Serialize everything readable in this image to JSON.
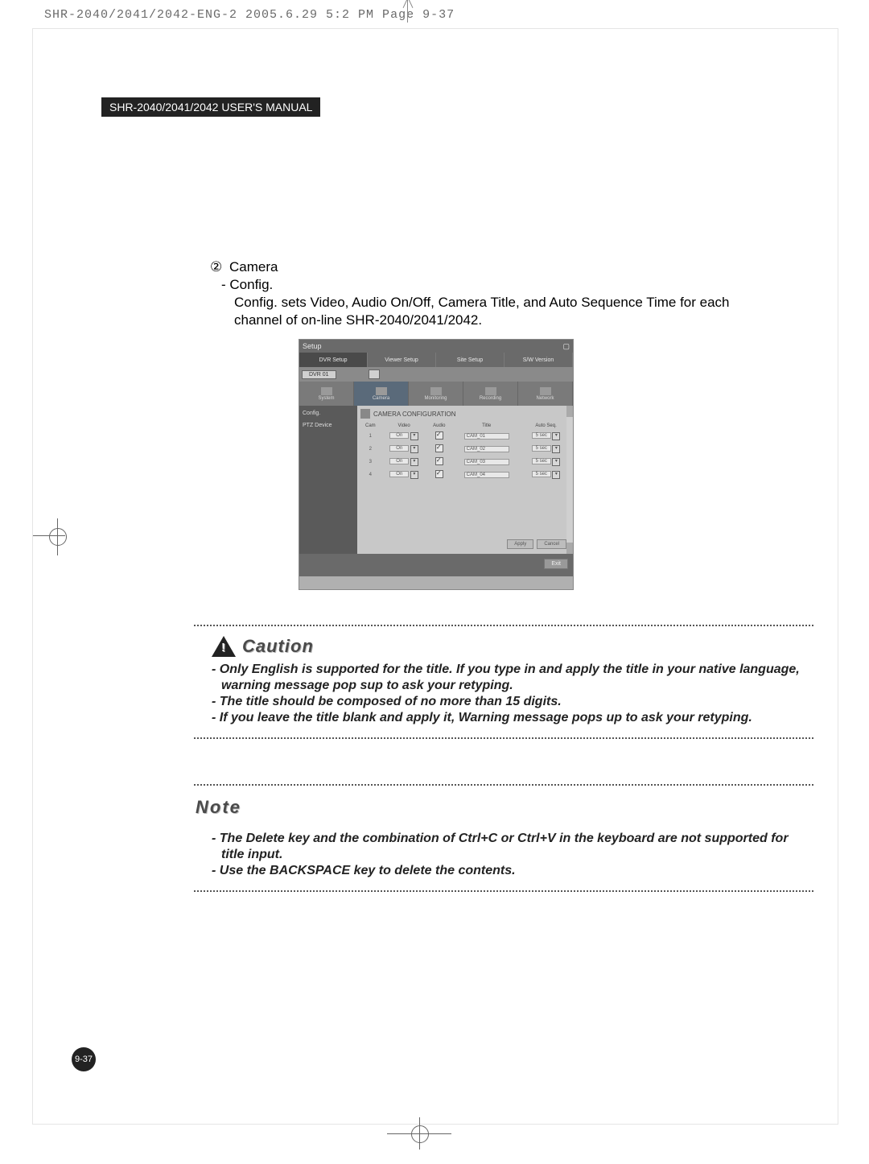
{
  "print_header": "SHR-2040/2041/2042-ENG-2  2005.6.29  5:2 PM  Page 9-37",
  "header_bar": "SHR-2040/2041/2042 USER'S MANUAL",
  "section": {
    "num": "②",
    "title": "Camera",
    "sub": "- Config.",
    "desc": "Config. sets Video, Audio On/Off, Camera Title, and Auto Sequence Time for each channel of on-line SHR-2040/2041/2042."
  },
  "screenshot": {
    "title": "Setup",
    "tabs": [
      "DVR Setup",
      "Viewer Setup",
      "Site Setup",
      "S/W Version"
    ],
    "dvr_label": "DVR 01",
    "navtabs": [
      "System",
      "Camera",
      "Monitoring",
      "Recording",
      "Network"
    ],
    "side": [
      "Config.",
      "PTZ Device"
    ],
    "main_title": "CAMERA CONFIGURATION",
    "columns": [
      "Cam",
      "Video",
      "Audio",
      "Title",
      "Auto Seq."
    ],
    "rows": [
      {
        "cam": "1",
        "video": "On",
        "title": "CAM_01",
        "autoseq": "5 sec"
      },
      {
        "cam": "2",
        "video": "On",
        "title": "CAM_02",
        "autoseq": "5 sec"
      },
      {
        "cam": "3",
        "video": "On",
        "title": "CAM_03",
        "autoseq": "5 sec"
      },
      {
        "cam": "4",
        "video": "On",
        "title": "CAM_04",
        "autoseq": "5 sec"
      }
    ],
    "buttons": [
      "Apply",
      "Cancel"
    ],
    "footer_button": "Exit"
  },
  "caution": {
    "title": "Caution",
    "items": [
      "- Only English is supported for the title. If you type in and apply the title in your native language, warning message pop sup to ask your retyping.",
      "- The title should be composed of no more than 15 digits.",
      "- If you leave the title blank and apply it, Warning message pops up to ask your retyping."
    ]
  },
  "note": {
    "title": "Note",
    "items": [
      "- The Delete key and the combination of Ctrl+C or Ctrl+V in the keyboard are not supported for title input.",
      "- Use the BACKSPACE key to delete the contents."
    ]
  },
  "page_num": "9-37"
}
